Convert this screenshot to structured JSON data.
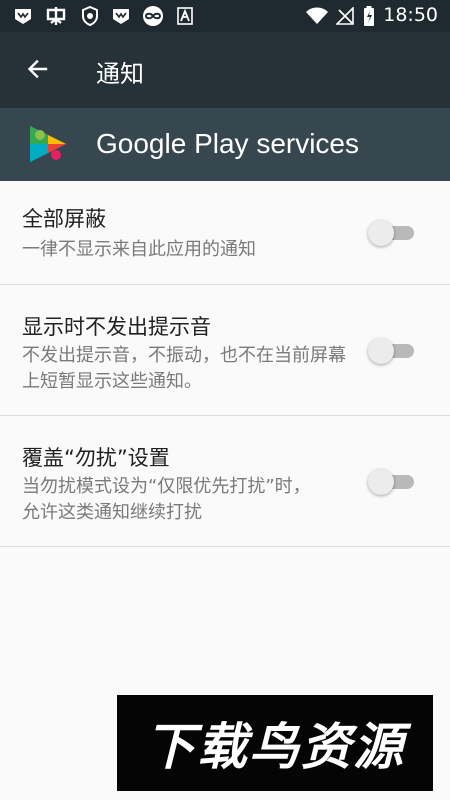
{
  "status_bar": {
    "time": "18:50",
    "left_icons": [
      "app-badge-icon",
      "ghost-icon",
      "shield-icon",
      "app-badge-icon",
      "infinity-icon",
      "letter-a-icon"
    ],
    "right_icons": [
      "wifi-icon",
      "no-signal-icon",
      "battery-charging-icon"
    ]
  },
  "toolbar": {
    "title": "通知",
    "back_icon": "arrow-back-icon"
  },
  "app_header": {
    "app_name": "Google Play services",
    "icon": "google-play-services-icon"
  },
  "settings": [
    {
      "title": "全部屏蔽",
      "subtitle": "一律不显示来自此应用的通知",
      "enabled": false
    },
    {
      "title": "显示时不发出提示音",
      "subtitle": "不发出提示音，不振动，也不在当前屏幕上短暂显示这些通知。",
      "enabled": false
    },
    {
      "title": "覆盖“勿扰”设置",
      "subtitle": "当勿扰模式设为“仅限优先打扰”时，允许这类通知继续打扰",
      "enabled": false
    }
  ],
  "watermark": {
    "text": "下载鸟资源"
  },
  "colors": {
    "status_bar": "#1f2a30",
    "toolbar": "#263238",
    "app_header": "#37474f",
    "background": "#fafafa",
    "switch_track_off": "#b9b9b9",
    "switch_thumb_off": "#ececec"
  }
}
